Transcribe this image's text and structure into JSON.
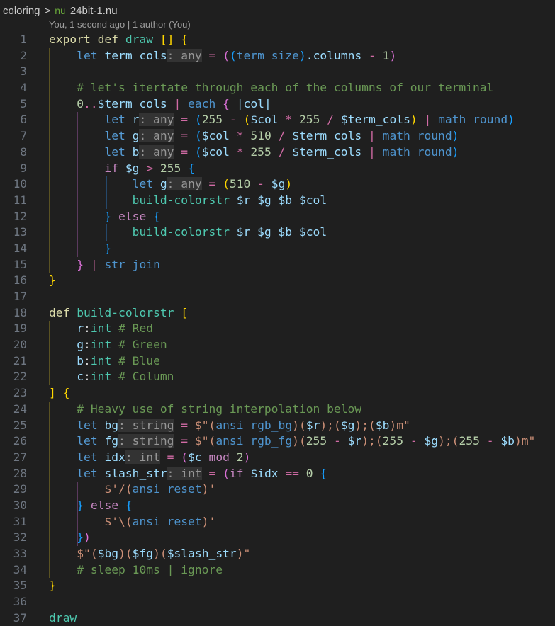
{
  "breadcrumb": {
    "folder": "coloring",
    "separator": ">",
    "lang_icon": "nu",
    "file": "24bit-1.nu"
  },
  "codelens": "You, 1 second ago | 1 author (You)",
  "lines": [
    {
      "n": "1"
    },
    {
      "n": "2"
    },
    {
      "n": "3"
    },
    {
      "n": "4"
    },
    {
      "n": "5"
    },
    {
      "n": "6"
    },
    {
      "n": "7"
    },
    {
      "n": "8"
    },
    {
      "n": "9"
    },
    {
      "n": "10"
    },
    {
      "n": "11"
    },
    {
      "n": "12"
    },
    {
      "n": "13"
    },
    {
      "n": "14"
    },
    {
      "n": "15"
    },
    {
      "n": "16"
    },
    {
      "n": "17"
    },
    {
      "n": "18"
    },
    {
      "n": "19"
    },
    {
      "n": "20"
    },
    {
      "n": "21"
    },
    {
      "n": "22"
    },
    {
      "n": "23"
    },
    {
      "n": "24"
    },
    {
      "n": "25"
    },
    {
      "n": "26"
    },
    {
      "n": "27"
    },
    {
      "n": "28"
    },
    {
      "n": "29"
    },
    {
      "n": "30"
    },
    {
      "n": "31"
    },
    {
      "n": "32"
    },
    {
      "n": "33"
    },
    {
      "n": "34"
    },
    {
      "n": "35"
    },
    {
      "n": "36"
    },
    {
      "n": "37"
    }
  ],
  "code": {
    "l1": [
      [
        "kw",
        "export def "
      ],
      [
        "fn",
        "draw "
      ],
      [
        "b1",
        "[]"
      ],
      [
        "plain",
        " "
      ],
      [
        "b1",
        "{"
      ]
    ],
    "l2": [
      [
        "plain",
        "    "
      ],
      [
        "kw2",
        "let "
      ],
      [
        "var",
        "term_cols"
      ],
      [
        "hint",
        ": any"
      ],
      [
        "op",
        " = "
      ],
      [
        "b2",
        "("
      ],
      [
        "b3",
        "("
      ],
      [
        "cmd",
        "term size"
      ],
      [
        "b3",
        ")"
      ],
      [
        "var",
        ".columns"
      ],
      [
        "op",
        " - "
      ],
      [
        "num",
        "1"
      ],
      [
        "b2",
        ")"
      ]
    ],
    "l3": [],
    "l4": [
      [
        "plain",
        "    "
      ],
      [
        "cm",
        "# let's itertate through each of the columns of our terminal"
      ]
    ],
    "l5": [
      [
        "plain",
        "    "
      ],
      [
        "num",
        "0"
      ],
      [
        "op",
        ".."
      ],
      [
        "var",
        "$term_cols"
      ],
      [
        "op",
        " | "
      ],
      [
        "cmd",
        "each "
      ],
      [
        "b2",
        "{"
      ],
      [
        "plain",
        " "
      ],
      [
        "var",
        "|col|"
      ]
    ],
    "l6": [
      [
        "plain",
        "        "
      ],
      [
        "kw2",
        "let "
      ],
      [
        "var",
        "r"
      ],
      [
        "hint",
        ": any"
      ],
      [
        "op",
        " = "
      ],
      [
        "b3",
        "("
      ],
      [
        "num",
        "255"
      ],
      [
        "op",
        " - "
      ],
      [
        "b1",
        "("
      ],
      [
        "var",
        "$col"
      ],
      [
        "op",
        " * "
      ],
      [
        "num",
        "255"
      ],
      [
        "op",
        " / "
      ],
      [
        "var",
        "$term_cols"
      ],
      [
        "b1",
        ")"
      ],
      [
        "op",
        " | "
      ],
      [
        "cmd",
        "math round"
      ],
      [
        "b3",
        ")"
      ]
    ],
    "l7": [
      [
        "plain",
        "        "
      ],
      [
        "kw2",
        "let "
      ],
      [
        "var",
        "g"
      ],
      [
        "hint",
        ": any"
      ],
      [
        "op",
        " = "
      ],
      [
        "b3",
        "("
      ],
      [
        "var",
        "$col"
      ],
      [
        "op",
        " * "
      ],
      [
        "num",
        "510"
      ],
      [
        "op",
        " / "
      ],
      [
        "var",
        "$term_cols"
      ],
      [
        "op",
        " | "
      ],
      [
        "cmd",
        "math round"
      ],
      [
        "b3",
        ")"
      ]
    ],
    "l8": [
      [
        "plain",
        "        "
      ],
      [
        "kw2",
        "let "
      ],
      [
        "var",
        "b"
      ],
      [
        "hint",
        ": any"
      ],
      [
        "op",
        " = "
      ],
      [
        "b3",
        "("
      ],
      [
        "var",
        "$col"
      ],
      [
        "op",
        " * "
      ],
      [
        "num",
        "255"
      ],
      [
        "op",
        " / "
      ],
      [
        "var",
        "$term_cols"
      ],
      [
        "op",
        " | "
      ],
      [
        "cmd",
        "math round"
      ],
      [
        "b3",
        ")"
      ]
    ],
    "l9": [
      [
        "plain",
        "        "
      ],
      [
        "ctl",
        "if "
      ],
      [
        "var",
        "$g"
      ],
      [
        "op",
        " > "
      ],
      [
        "num",
        "255 "
      ],
      [
        "b3",
        "{"
      ]
    ],
    "l10": [
      [
        "plain",
        "            "
      ],
      [
        "kw2",
        "let "
      ],
      [
        "var",
        "g"
      ],
      [
        "hint",
        ": any"
      ],
      [
        "op",
        " = "
      ],
      [
        "b1",
        "("
      ],
      [
        "num",
        "510"
      ],
      [
        "op",
        " - "
      ],
      [
        "var",
        "$g"
      ],
      [
        "b1",
        ")"
      ]
    ],
    "l11": [
      [
        "plain",
        "            "
      ],
      [
        "fn",
        "build-colorstr "
      ],
      [
        "var",
        "$r $g $b $col"
      ]
    ],
    "l12": [
      [
        "plain",
        "        "
      ],
      [
        "b3",
        "}"
      ],
      [
        "ctl",
        " else "
      ],
      [
        "b3",
        "{"
      ]
    ],
    "l13": [
      [
        "plain",
        "            "
      ],
      [
        "fn",
        "build-colorstr "
      ],
      [
        "var",
        "$r $g $b $col"
      ]
    ],
    "l14": [
      [
        "plain",
        "        "
      ],
      [
        "b3",
        "}"
      ]
    ],
    "l15": [
      [
        "plain",
        "    "
      ],
      [
        "b2",
        "}"
      ],
      [
        "op",
        " | "
      ],
      [
        "cmd",
        "str join"
      ]
    ],
    "l16": [
      [
        "b1",
        "}"
      ]
    ],
    "l17": [],
    "l18": [
      [
        "kw",
        "def "
      ],
      [
        "fn",
        "build-colorstr "
      ],
      [
        "b1",
        "["
      ]
    ],
    "l19": [
      [
        "plain",
        "    "
      ],
      [
        "var",
        "r"
      ],
      [
        "plain",
        ":"
      ],
      [
        "fn",
        "int "
      ],
      [
        "cm",
        "# Red"
      ]
    ],
    "l20": [
      [
        "plain",
        "    "
      ],
      [
        "var",
        "g"
      ],
      [
        "plain",
        ":"
      ],
      [
        "fn",
        "int "
      ],
      [
        "cm",
        "# Green"
      ]
    ],
    "l21": [
      [
        "plain",
        "    "
      ],
      [
        "var",
        "b"
      ],
      [
        "plain",
        ":"
      ],
      [
        "fn",
        "int "
      ],
      [
        "cm",
        "# Blue"
      ]
    ],
    "l22": [
      [
        "plain",
        "    "
      ],
      [
        "var",
        "c"
      ],
      [
        "plain",
        ":"
      ],
      [
        "fn",
        "int "
      ],
      [
        "cm",
        "# Column"
      ]
    ],
    "l23": [
      [
        "b1",
        "]"
      ],
      [
        "plain",
        " "
      ],
      [
        "b1",
        "{"
      ]
    ],
    "l24": [
      [
        "plain",
        "    "
      ],
      [
        "cm",
        "# Heavy use of string interpolation below"
      ]
    ],
    "l25": [
      [
        "plain",
        "    "
      ],
      [
        "kw2",
        "let "
      ],
      [
        "var",
        "bg"
      ],
      [
        "hint",
        ": string"
      ],
      [
        "op",
        " = "
      ],
      [
        "str",
        "$\"("
      ],
      [
        "cmd",
        "ansi rgb_bg"
      ],
      [
        "str",
        ")("
      ],
      [
        "var",
        "$r"
      ],
      [
        "str",
        ");("
      ],
      [
        "var",
        "$g"
      ],
      [
        "str",
        ");("
      ],
      [
        "var",
        "$b"
      ],
      [
        "str",
        ")m\""
      ]
    ],
    "l26": [
      [
        "plain",
        "    "
      ],
      [
        "kw2",
        "let "
      ],
      [
        "var",
        "fg"
      ],
      [
        "hint",
        ": string"
      ],
      [
        "op",
        " = "
      ],
      [
        "str",
        "$\"("
      ],
      [
        "cmd",
        "ansi rgb_fg"
      ],
      [
        "str",
        ")("
      ],
      [
        "num",
        "255"
      ],
      [
        "op",
        " - "
      ],
      [
        "var",
        "$r"
      ],
      [
        "str",
        ");("
      ],
      [
        "num",
        "255"
      ],
      [
        "op",
        " - "
      ],
      [
        "var",
        "$g"
      ],
      [
        "str",
        ");("
      ],
      [
        "num",
        "255"
      ],
      [
        "op",
        " - "
      ],
      [
        "var",
        "$b"
      ],
      [
        "str",
        ")m\""
      ]
    ],
    "l27": [
      [
        "plain",
        "    "
      ],
      [
        "kw2",
        "let "
      ],
      [
        "var",
        "idx"
      ],
      [
        "hint",
        ": int"
      ],
      [
        "op",
        " = "
      ],
      [
        "b2",
        "("
      ],
      [
        "var",
        "$c "
      ],
      [
        "ctl",
        "mod "
      ],
      [
        "num",
        "2"
      ],
      [
        "b2",
        ")"
      ]
    ],
    "l28": [
      [
        "plain",
        "    "
      ],
      [
        "kw2",
        "let "
      ],
      [
        "var",
        "slash_str"
      ],
      [
        "hint",
        ": int"
      ],
      [
        "op",
        " = "
      ],
      [
        "b2",
        "("
      ],
      [
        "ctl",
        "if "
      ],
      [
        "var",
        "$idx"
      ],
      [
        "op",
        " == "
      ],
      [
        "num",
        "0 "
      ],
      [
        "b3",
        "{"
      ]
    ],
    "l29": [
      [
        "plain",
        "        "
      ],
      [
        "str",
        "$'/("
      ],
      [
        "cmd",
        "ansi reset"
      ],
      [
        "str",
        ")'"
      ]
    ],
    "l30": [
      [
        "plain",
        "    "
      ],
      [
        "b3",
        "}"
      ],
      [
        "ctl",
        " else "
      ],
      [
        "b3",
        "{"
      ]
    ],
    "l31": [
      [
        "plain",
        "        "
      ],
      [
        "str",
        "$'\\("
      ],
      [
        "cmd",
        "ansi reset"
      ],
      [
        "str",
        ")'"
      ]
    ],
    "l32": [
      [
        "plain",
        "    "
      ],
      [
        "b3",
        "}"
      ],
      [
        "b2",
        ")"
      ]
    ],
    "l33": [
      [
        "plain",
        "    "
      ],
      [
        "str",
        "$\"("
      ],
      [
        "var",
        "$bg"
      ],
      [
        "str",
        ")("
      ],
      [
        "var",
        "$fg"
      ],
      [
        "str",
        ")("
      ],
      [
        "var",
        "$slash_str"
      ],
      [
        "str",
        ")\""
      ]
    ],
    "l34": [
      [
        "plain",
        "    "
      ],
      [
        "cm",
        "# sleep 10ms | ignore"
      ]
    ],
    "l35": [
      [
        "b1",
        "}"
      ]
    ],
    "l36": [],
    "l37": [
      [
        "fn",
        "draw"
      ]
    ]
  },
  "guides": {
    "l2": [
      "g1"
    ],
    "l3": [
      "g1"
    ],
    "l4": [
      "g1"
    ],
    "l5": [
      "g1"
    ],
    "l6": [
      "g1",
      "g2"
    ],
    "l7": [
      "g1",
      "g2"
    ],
    "l8": [
      "g1",
      "g2"
    ],
    "l9": [
      "g1",
      "g2"
    ],
    "l10": [
      "g1",
      "g2",
      "g3"
    ],
    "l11": [
      "g1",
      "g2",
      "g3"
    ],
    "l12": [
      "g1",
      "g2"
    ],
    "l13": [
      "g1",
      "g2",
      "g3"
    ],
    "l14": [
      "g1",
      "g2"
    ],
    "l15": [
      "g1"
    ],
    "l19": [
      "g1"
    ],
    "l20": [
      "g1"
    ],
    "l21": [
      "g1"
    ],
    "l22": [
      "g1"
    ],
    "l24": [
      "g1"
    ],
    "l25": [
      "g1"
    ],
    "l26": [
      "g1"
    ],
    "l27": [
      "g1"
    ],
    "l28": [
      "g1"
    ],
    "l29": [
      "g1",
      "g2"
    ],
    "l30": [
      "g1",
      "g2"
    ],
    "l31": [
      "g1",
      "g2"
    ],
    "l32": [
      "g1",
      "g2"
    ],
    "l33": [
      "g1"
    ],
    "l34": [
      "g1"
    ]
  }
}
